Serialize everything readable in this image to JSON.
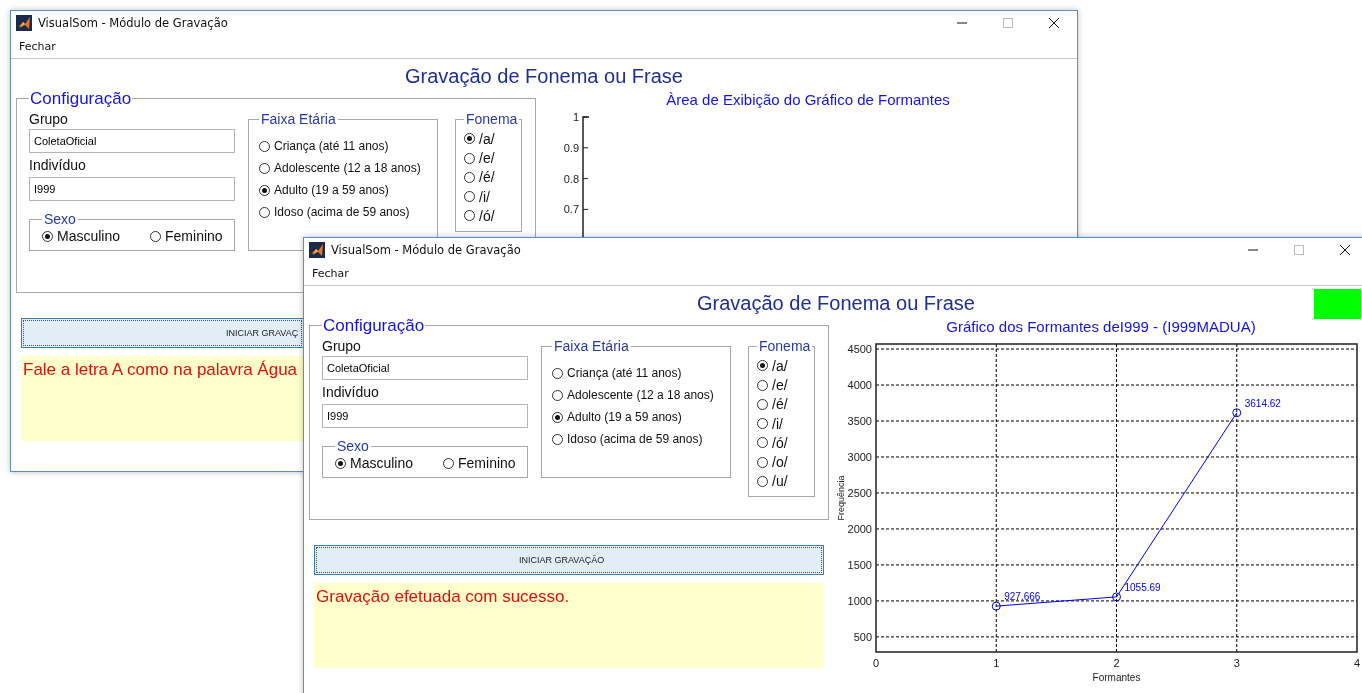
{
  "windows": [
    {
      "title": "VisualSom - Módulo de Gravação",
      "menu": [
        "Fechar"
      ],
      "heading": "Gravação de Fonema ou Frase",
      "configuration": {
        "legend": "Configuração",
        "group_label": "Grupo",
        "group_value": "ColetaOficial",
        "individual_label": "Indivíduo",
        "individual_value": "I999",
        "sex": {
          "legend": "Sexo",
          "options": [
            {
              "label": "Masculino",
              "selected": true
            },
            {
              "label": "Feminino",
              "selected": false
            }
          ]
        },
        "age_range": {
          "legend": "Faixa Etária",
          "options": [
            {
              "label": "Criança (até 11 anos)",
              "selected": false
            },
            {
              "label": "Adolescente (12 a 18 anos)",
              "selected": false
            },
            {
              "label": "Adulto (19 a 59 anos)",
              "selected": true
            },
            {
              "label": "Idoso (acima de 59 anos)",
              "selected": false
            }
          ]
        },
        "phoneme": {
          "legend": "Fonema",
          "options": [
            {
              "label": "/a/",
              "selected": true
            },
            {
              "label": "/e/",
              "selected": false
            },
            {
              "label": "/é/",
              "selected": false
            },
            {
              "label": "/i/",
              "selected": false
            },
            {
              "label": "/ó/",
              "selected": false
            }
          ]
        }
      },
      "chart": {
        "axis_panel": {
          "title": "Àrea de Exibição do Gráfico de Formantes",
          "tick_labels": [
            "1",
            "0.9",
            "0.8",
            "0.7"
          ]
        }
      },
      "record_button": "INICIAR GRAVAÇ",
      "message": "Fale a letra A como na palavra Água"
    },
    {
      "title": "VisualSom - Módulo de Gravação",
      "menu": [
        "Fechar"
      ],
      "heading": "Gravação de Fonema ou Frase",
      "status_light": {
        "on": true
      },
      "configuration": {
        "legend": "Configuração",
        "group_label": "Grupo",
        "group_value": "ColetaOficial",
        "individual_label": "Indivíduo",
        "individual_value": "I999",
        "sex": {
          "legend": "Sexo",
          "options": [
            {
              "label": "Masculino",
              "selected": true
            },
            {
              "label": "Feminino",
              "selected": false
            }
          ]
        },
        "age_range": {
          "legend": "Faixa Etária",
          "options": [
            {
              "label": "Criança (até 11 anos)",
              "selected": false
            },
            {
              "label": "Adolescente (12 a 18 anos)",
              "selected": false
            },
            {
              "label": "Adulto (19 a 59 anos)",
              "selected": true
            },
            {
              "label": "Idoso (acima de 59 anos)",
              "selected": false
            }
          ]
        },
        "phoneme": {
          "legend": "Fonema",
          "options": [
            {
              "label": "/a/",
              "selected": true
            },
            {
              "label": "/e/",
              "selected": false
            },
            {
              "label": "/é/",
              "selected": false
            },
            {
              "label": "/i/",
              "selected": false
            },
            {
              "label": "/ó/",
              "selected": false
            },
            {
              "label": "/o/",
              "selected": false
            },
            {
              "label": "/u/",
              "selected": false
            }
          ]
        }
      },
      "chart": {
        "chart_data": {
          "type": "line",
          "title": "Gráfico dos Formantes deI999 - (I999MADUA)",
          "xlabel": "Formantes",
          "ylabel": "Frequência",
          "x": [
            1,
            2,
            3
          ],
          "series": [
            {
              "color": "#0000ff",
              "marker": "o",
              "values": [
                927.666,
                1055.69,
                3614.62
              ]
            }
          ],
          "xlim": [
            0,
            4
          ],
          "ylim": [
            290,
            4570
          ],
          "xticks": [
            0,
            1,
            2,
            3,
            4
          ],
          "yticks": [
            500,
            1000,
            1500,
            2000,
            2500,
            3000,
            3500,
            4000,
            4500
          ],
          "grid": true,
          "data_labels": true
        }
      },
      "record_button": "INICIAR GRAVAÇÃO",
      "message": "Gravação efetuada com sucesso."
    }
  ]
}
